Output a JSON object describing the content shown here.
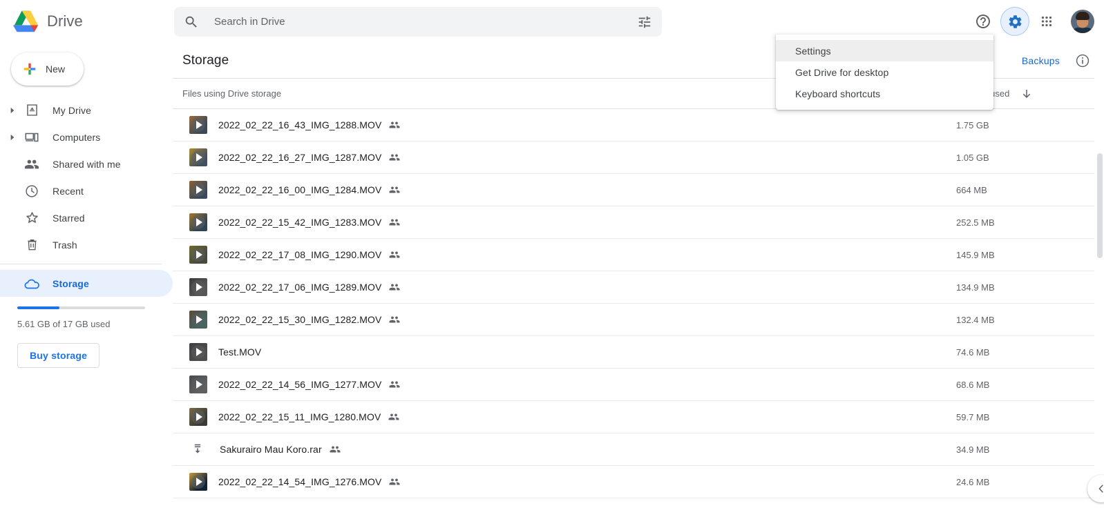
{
  "app": {
    "brand_name": "Drive",
    "logo_icon": "drive-logo-icon"
  },
  "search": {
    "placeholder": "Search in Drive",
    "value": "",
    "search_icon": "search-icon",
    "options_icon": "tune-icon"
  },
  "header_actions": {
    "help_icon": "help-circle-icon",
    "settings_icon": "gear-icon",
    "apps_icon": "apps-grid-icon",
    "account_icon": "avatar"
  },
  "sidebar": {
    "new_button_label": "New",
    "items": [
      {
        "label": "My Drive",
        "icon": "my-drive-icon",
        "expandable": true,
        "selected": false
      },
      {
        "label": "Computers",
        "icon": "computers-icon",
        "expandable": true,
        "selected": false
      },
      {
        "label": "Shared with me",
        "icon": "shared-with-me-icon",
        "expandable": false,
        "selected": false
      },
      {
        "label": "Recent",
        "icon": "clock-icon",
        "expandable": false,
        "selected": false
      },
      {
        "label": "Starred",
        "icon": "star-icon",
        "expandable": false,
        "selected": false
      },
      {
        "label": "Trash",
        "icon": "trash-icon",
        "expandable": false,
        "selected": false
      },
      {
        "label": "Storage",
        "icon": "cloud-icon",
        "expandable": false,
        "selected": true
      }
    ],
    "storage": {
      "used_text": "5.61 GB of 17 GB used",
      "percent": 33,
      "buy_label": "Buy storage",
      "accent_color": "#1a73e8",
      "track_color": "#dadce0"
    }
  },
  "main": {
    "page_title": "Storage",
    "backups_label": "Backups",
    "info_icon": "info-circle-icon",
    "list_caption": "Files using Drive storage",
    "sort_column_label": "Storage used",
    "sort_direction_icon": "arrow-down-icon",
    "files": [
      {
        "name": "2022_02_22_16_43_IMG_1288.MOV",
        "size": "1.75 GB",
        "type": "video",
        "shared": true,
        "thumb_a": "#9a6b3a",
        "thumb_b": "#3b4a57"
      },
      {
        "name": "2022_02_22_16_27_IMG_1287.MOV",
        "size": "1.05 GB",
        "type": "video",
        "shared": true,
        "thumb_a": "#b08a2e",
        "thumb_b": "#40505e"
      },
      {
        "name": "2022_02_22_16_00_IMG_1284.MOV",
        "size": "664 MB",
        "type": "video",
        "shared": true,
        "thumb_a": "#8d5f34",
        "thumb_b": "#3a4a58"
      },
      {
        "name": "2022_02_22_15_42_IMG_1283.MOV",
        "size": "252.5 MB",
        "type": "video",
        "shared": true,
        "thumb_a": "#a4762c",
        "thumb_b": "#2f4352"
      },
      {
        "name": "2022_02_22_17_08_IMG_1290.MOV",
        "size": "145.9 MB",
        "type": "video",
        "shared": true,
        "thumb_a": "#6d6a2f",
        "thumb_b": "#4a4a3a"
      },
      {
        "name": "2022_02_22_17_06_IMG_1289.MOV",
        "size": "134.9 MB",
        "type": "video",
        "shared": true,
        "thumb_a": "#3a3a3a",
        "thumb_b": "#565656"
      },
      {
        "name": "2022_02_22_15_30_IMG_1282.MOV",
        "size": "132.4 MB",
        "type": "video",
        "shared": true,
        "thumb_a": "#5b4a38",
        "thumb_b": "#45655f"
      },
      {
        "name": "Test.MOV",
        "size": "74.6 MB",
        "type": "video",
        "shared": false,
        "thumb_a": "#3f3f3f",
        "thumb_b": "#4d4d4d"
      },
      {
        "name": "2022_02_22_14_56_IMG_1277.MOV",
        "size": "68.6 MB",
        "type": "video",
        "shared": true,
        "thumb_a": "#4a4a4a",
        "thumb_b": "#606060"
      },
      {
        "name": "2022_02_22_15_11_IMG_1280.MOV",
        "size": "59.7 MB",
        "type": "video",
        "shared": true,
        "thumb_a": "#7a6a4a",
        "thumb_b": "#3d3a32"
      },
      {
        "name": "Sakurairo Mau Koro.rar",
        "size": "34.9 MB",
        "type": "archive",
        "shared": true,
        "thumb_a": "",
        "thumb_b": ""
      },
      {
        "name": "2022_02_22_14_54_IMG_1276.MOV",
        "size": "24.6 MB",
        "type": "video",
        "shared": true,
        "thumb_a": "#c79a3a",
        "thumb_b": "#0f2236"
      }
    ]
  },
  "settings_menu": {
    "open": true,
    "items": [
      {
        "label": "Settings",
        "hovered": true
      },
      {
        "label": "Get Drive for desktop",
        "hovered": false
      },
      {
        "label": "Keyboard shortcuts",
        "hovered": false
      }
    ]
  },
  "collapse_button": {
    "icon": "chevron-left-icon"
  },
  "scrollbar": {
    "thumb_color": "#dadce0"
  }
}
